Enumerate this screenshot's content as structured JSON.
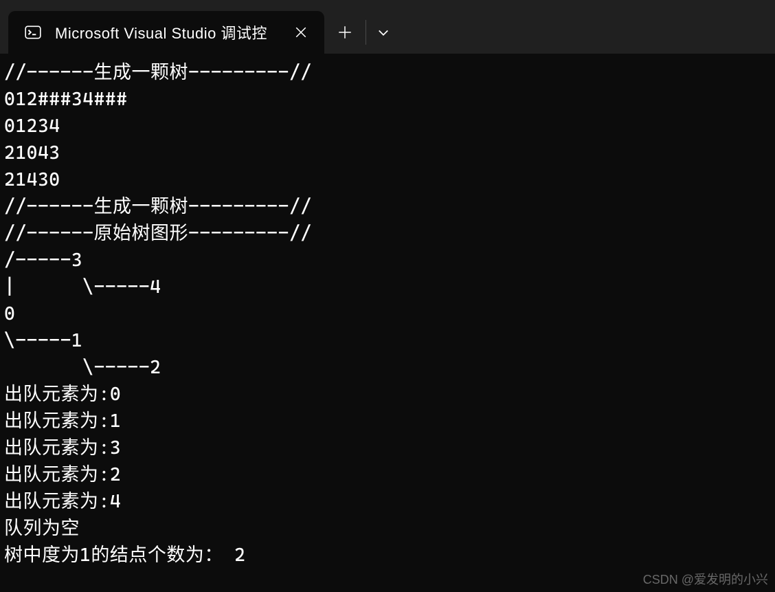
{
  "tab": {
    "title": "Microsoft Visual Studio 调试控"
  },
  "console": {
    "lines": [
      "//------生成一颗树---------//",
      "012###34###",
      "01234",
      "21043",
      "21430",
      "//------生成一颗树---------//",
      "//------原始树图形---------//",
      "/-----3",
      "|      \\-----4",
      "0",
      "\\-----1",
      "       \\-----2",
      "出队元素为:0",
      "出队元素为:1",
      "出队元素为:3",
      "出队元素为:2",
      "出队元素为:4",
      "队列为空",
      "树中度为1的结点个数为： 2"
    ]
  },
  "watermark": "CSDN @爱发明的小兴"
}
